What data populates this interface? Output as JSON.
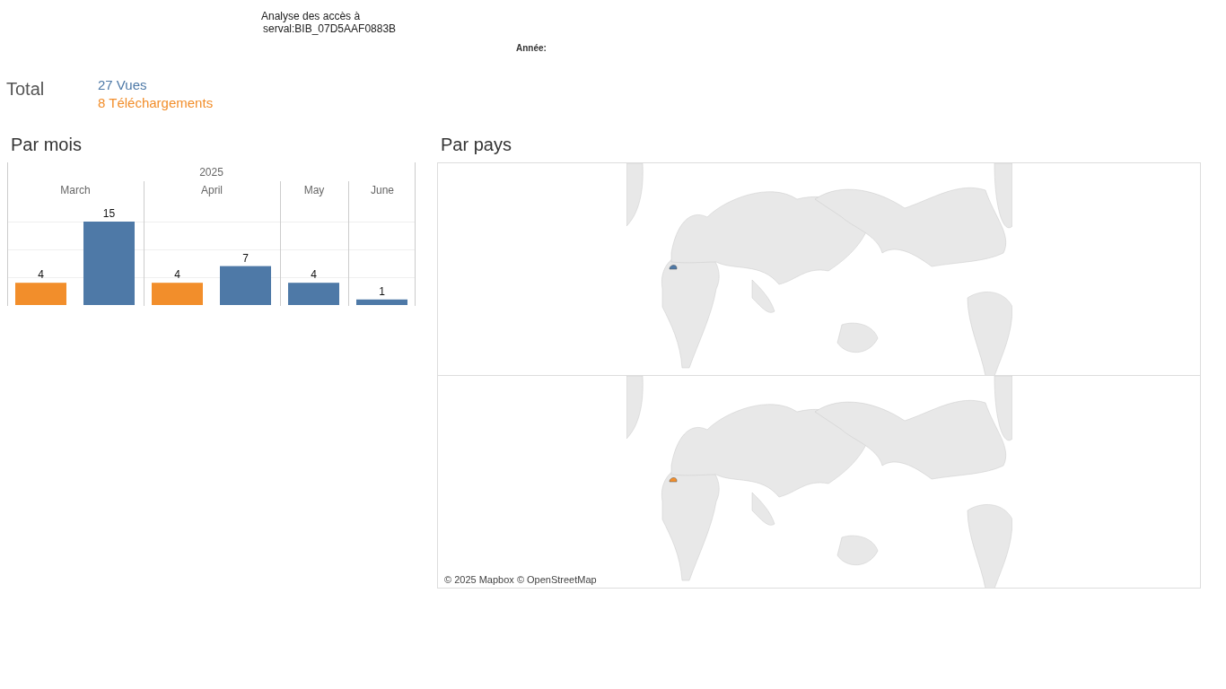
{
  "header": {
    "title_line_1": "Analyse des accès à",
    "title_line_2": "serval:BIB_07D5AAF0883B",
    "year_filter_label": "Année:"
  },
  "totals": {
    "label": "Total",
    "items": [
      {
        "text": "27 Vues",
        "color": "#4e79a7"
      },
      {
        "text": "8 Téléchargements",
        "color": "#f28e2b"
      }
    ]
  },
  "by_month": {
    "title": "Par mois",
    "year_header": "2025",
    "chart_data": {
      "type": "bar",
      "categories": [
        "March",
        "April",
        "May",
        "June"
      ],
      "data_labels": true,
      "series": [
        {
          "color": "#f28e2b",
          "values": [
            4,
            4,
            null,
            null
          ]
        },
        {
          "color": "#4e79a7",
          "values": [
            15,
            7,
            4,
            1
          ]
        }
      ]
    }
  },
  "by_country": {
    "title": "Par pays",
    "maps": [
      {
        "color": "#4e79a7"
      },
      {
        "color": "#f28e2b"
      }
    ],
    "attribution": "© 2025 Mapbox © OpenStreetMap"
  }
}
